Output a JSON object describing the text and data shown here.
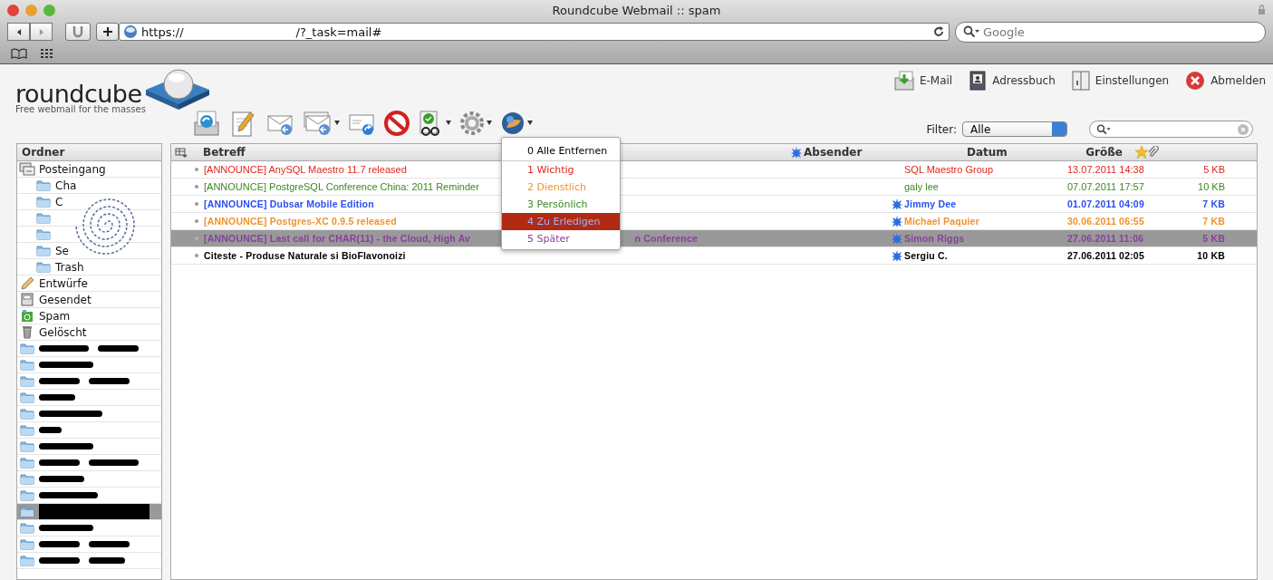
{
  "window": {
    "title": "Roundcube Webmail :: spam"
  },
  "browser": {
    "url": "https://                              /?_task=mail#",
    "search_placeholder": "Google"
  },
  "logo": {
    "name": "roundcube",
    "tagline": "Free webmail for the masses"
  },
  "nav": [
    {
      "label": "E-Mail",
      "kind": "mail"
    },
    {
      "label": "Adressbuch",
      "kind": "book"
    },
    {
      "label": "Einstellungen",
      "kind": "settings"
    },
    {
      "label": "Abmelden",
      "kind": "logout"
    }
  ],
  "toolbar": [
    {
      "kind": "refresh",
      "caret": false
    },
    {
      "kind": "compose",
      "caret": false
    },
    {
      "kind": "reply",
      "caret": false
    },
    {
      "kind": "replyall",
      "caret": true
    },
    {
      "kind": "forward",
      "caret": false
    },
    {
      "kind": "delete",
      "caret": false
    },
    {
      "kind": "mark",
      "caret": true
    },
    {
      "kind": "gear",
      "caret": true
    },
    {
      "kind": "globe",
      "caret": true
    }
  ],
  "filter": {
    "label": "Filter:",
    "value": "Alle"
  },
  "sidebar": {
    "title": "Ordner",
    "folders": [
      {
        "kind": "inbox",
        "label": "Posteingang",
        "selected": false,
        "children": [
          {
            "label": "Cha",
            "selected": false
          },
          {
            "label": "C",
            "selected": false
          },
          {
            "selected": false
          },
          {
            "selected": false
          },
          {
            "label": "Se",
            "selected": false
          },
          {
            "label": "Trash",
            "selected": false
          }
        ]
      },
      {
        "kind": "drafts",
        "label": "Entwürfe",
        "selected": false
      },
      {
        "kind": "sent",
        "label": "Gesendet",
        "selected": false
      },
      {
        "kind": "spam",
        "label": "Spam",
        "selected": false
      },
      {
        "kind": "trash",
        "label": "Gelöscht",
        "selected": false
      },
      {
        "kind": "redacted",
        "selected": false
      },
      {
        "kind": "redacted",
        "selected": false
      },
      {
        "kind": "redacted",
        "selected": false
      },
      {
        "kind": "redacted",
        "selected": false
      },
      {
        "kind": "redacted",
        "selected": false
      },
      {
        "kind": "redacted",
        "selected": false
      },
      {
        "kind": "redacted",
        "selected": false
      },
      {
        "kind": "redacted",
        "selected": false
      },
      {
        "kind": "redacted",
        "selected": false
      },
      {
        "kind": "redacted",
        "selected": false
      },
      {
        "kind": "redacted",
        "selected": true
      },
      {
        "kind": "redacted",
        "selected": false
      },
      {
        "kind": "redacted",
        "selected": false
      },
      {
        "kind": "redacted",
        "selected": false
      }
    ]
  },
  "table": {
    "columns": [
      "Betreff",
      "Absender",
      "Datum",
      "Größe"
    ],
    "rows": [
      {
        "subject": "[ANNOUNCE] AnySQL Maestro 11.7 released",
        "sender": "SQL Maestro Group",
        "date": "13.07.2011 14:38",
        "size": "5 KB",
        "color": "#e0261b",
        "unread": false,
        "selected": false
      },
      {
        "subject": "[ANNOUNCE] PostgreSQL Conference China: 2011 Reminder",
        "sender": "galy lee",
        "date": "07.07.2011 17:57",
        "size": "10 KB",
        "color": "#3a8a1e",
        "unread": false,
        "selected": false
      },
      {
        "subject": "[ANNOUNCE] Dubsar Mobile Edition",
        "sender": "Jimmy Dee",
        "date": "01.07.2011 04:09",
        "size": "7 KB",
        "color": "#2a4ef0",
        "unread": true,
        "selected": false
      },
      {
        "subject": "[ANNOUNCE] Postgres-XC 0.9.5 released",
        "sender": "Michael Paquier",
        "date": "30.06.2011 06:55",
        "size": "7 KB",
        "color": "#f0922a",
        "unread": true,
        "selected": false
      },
      {
        "subject": "[ANNOUNCE] Last call for CHAR(11) - the Cloud, High Av",
        "subject_tail": "n Conference",
        "sender": "Simon Riggs",
        "date": "27.06.2011 11:06",
        "size": "5 KB",
        "color": "#8a3ea0",
        "unread": true,
        "selected": true
      },
      {
        "subject": "Citeste - Produse Naturale si BioFlavonoizi",
        "sender": "Sergiu C.",
        "date": "27.06.2011 02:05",
        "size": "10 KB",
        "color": "#000000",
        "unread": true,
        "selected": false
      }
    ]
  },
  "flag_menu": {
    "items": [
      {
        "label": "0 Alle Entfernen",
        "color": "#000000",
        "selected": false
      },
      {
        "label": "1 Wichtig",
        "color": "#e0261b",
        "selected": false
      },
      {
        "label": "2 Dienstlich",
        "color": "#f0922a",
        "selected": false
      },
      {
        "label": "3 Persönlich",
        "color": "#3a8a1e",
        "selected": false
      },
      {
        "label": "4 Zu Erledigen",
        "color": "#9db4ff",
        "selected": true
      },
      {
        "label": "5 Später",
        "color": "#8a3ea0",
        "selected": false
      }
    ]
  }
}
